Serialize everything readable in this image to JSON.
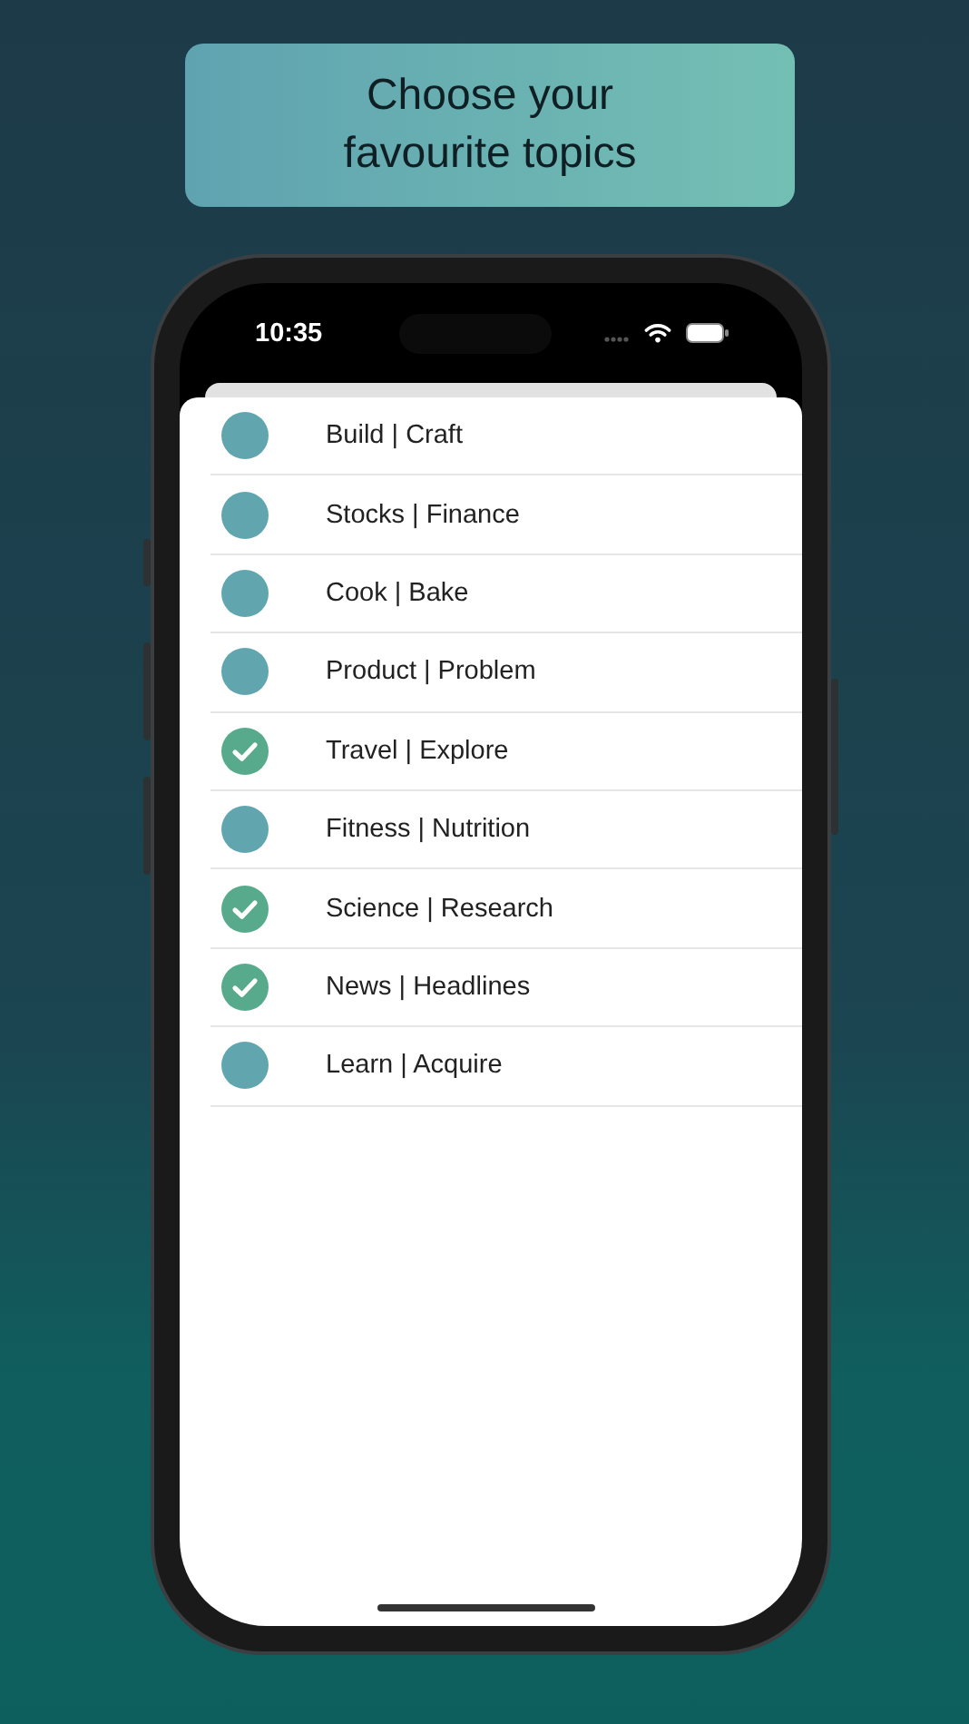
{
  "banner": {
    "title": "Choose your\nfavourite topics"
  },
  "status_bar": {
    "time": "10:35"
  },
  "topics": [
    {
      "label": "Build | Craft",
      "selected": false
    },
    {
      "label": "Stocks | Finance",
      "selected": false
    },
    {
      "label": "Cook | Bake",
      "selected": false
    },
    {
      "label": "Product | Problem",
      "selected": false
    },
    {
      "label": "Travel | Explore",
      "selected": true
    },
    {
      "label": "Fitness | Nutrition",
      "selected": false
    },
    {
      "label": "Science | Research",
      "selected": true
    },
    {
      "label": "News | Headlines",
      "selected": true
    },
    {
      "label": "Learn | Acquire",
      "selected": false
    }
  ]
}
